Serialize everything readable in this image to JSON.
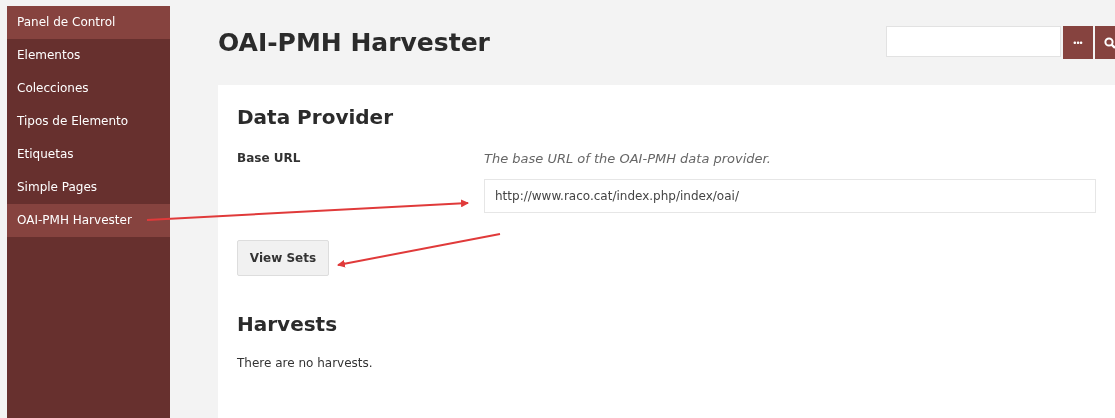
{
  "sidebar": {
    "items": [
      {
        "label": "Panel de Control",
        "selected": true
      },
      {
        "label": "Elementos",
        "selected": false
      },
      {
        "label": "Colecciones",
        "selected": false
      },
      {
        "label": "Tipos de Elemento",
        "selected": false
      },
      {
        "label": "Etiquetas",
        "selected": false
      },
      {
        "label": "Simple Pages",
        "selected": false
      },
      {
        "label": "OAI-PMH Harvester",
        "selected": true
      }
    ]
  },
  "page_title": "OAI-PMH Harvester",
  "search": {
    "more_button": "•••"
  },
  "data_provider": {
    "heading": "Data Provider",
    "field_label": "Base URL",
    "hint": "The base URL of the OAI-PMH data provider.",
    "value": "http://www.raco.cat/index.php/index/oai/",
    "button": "View Sets"
  },
  "harvests": {
    "heading": "Harvests",
    "message": "There are no harvests."
  }
}
